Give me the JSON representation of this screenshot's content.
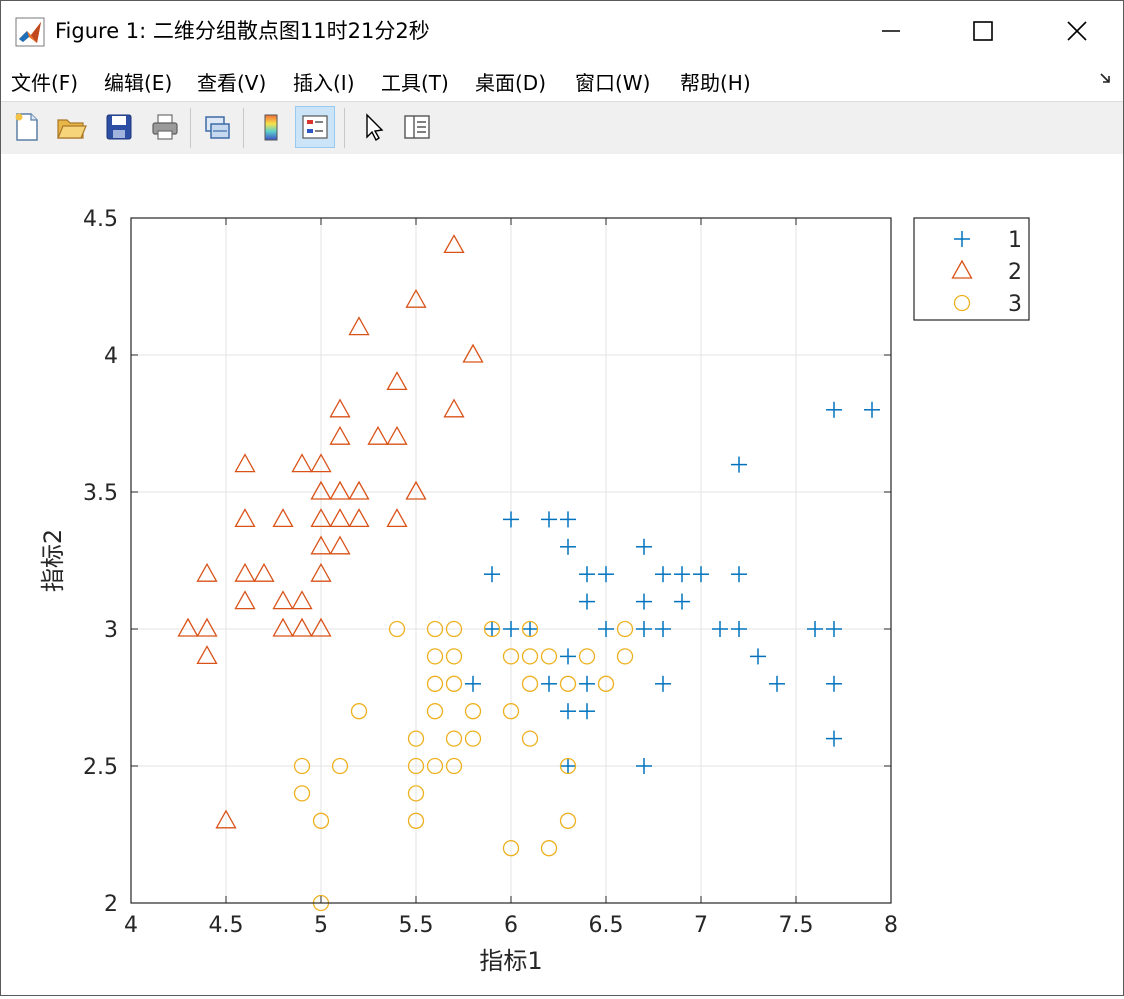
{
  "window": {
    "title": "Figure 1: 二维分组散点图11时21分2秒",
    "controls": {
      "minimize": "—",
      "maximize": "☐",
      "close": "✕"
    }
  },
  "menubar": {
    "items": [
      {
        "label": "文件(F)",
        "name": "menu-file"
      },
      {
        "label": "编辑(E)",
        "name": "menu-edit"
      },
      {
        "label": "查看(V)",
        "name": "menu-view"
      },
      {
        "label": "插入(I)",
        "name": "menu-insert"
      },
      {
        "label": "工具(T)",
        "name": "menu-tools"
      },
      {
        "label": "桌面(D)",
        "name": "menu-desktop"
      },
      {
        "label": "窗口(W)",
        "name": "menu-window"
      },
      {
        "label": "帮助(H)",
        "name": "menu-help"
      }
    ]
  },
  "toolbar": {
    "buttons": [
      {
        "icon": "new-figure-icon"
      },
      {
        "icon": "open-file-icon"
      },
      {
        "icon": "save-icon"
      },
      {
        "icon": "print-icon"
      },
      {
        "icon": "link-plot-icon"
      },
      {
        "icon": "colorbar-icon"
      },
      {
        "icon": "legend-icon",
        "active": true
      },
      {
        "icon": "edit-plot-pointer-icon"
      },
      {
        "icon": "property-inspector-icon"
      }
    ]
  },
  "chart_data": {
    "type": "scatter",
    "title": "",
    "xlabel": "指标1",
    "ylabel": "指标2",
    "xlim": [
      4,
      8
    ],
    "ylim": [
      2,
      4.5
    ],
    "xticks": [
      4,
      4.5,
      5,
      5.5,
      6,
      6.5,
      7,
      7.5,
      8
    ],
    "xtick_labels": [
      "4",
      "4.5",
      "5",
      "5.5",
      "6",
      "6.5",
      "7",
      "7.5",
      "8"
    ],
    "yticks": [
      2,
      2.5,
      3,
      3.5,
      4,
      4.5
    ],
    "ytick_labels": [
      "2",
      "2.5",
      "3",
      "3.5",
      "4",
      "4.5"
    ],
    "grid": true,
    "legend": "outside top-right",
    "series": [
      {
        "name": "1",
        "marker": "plus",
        "color": "#0072BD",
        "points": [
          [
            5.8,
            2.8
          ],
          [
            5.9,
            3.2
          ],
          [
            5.9,
            3.0
          ],
          [
            6.0,
            3.4
          ],
          [
            6.0,
            3.0
          ],
          [
            6.1,
            3.0
          ],
          [
            6.2,
            3.4
          ],
          [
            6.2,
            2.8
          ],
          [
            6.3,
            3.4
          ],
          [
            6.3,
            3.3
          ],
          [
            6.3,
            2.9
          ],
          [
            6.3,
            2.7
          ],
          [
            6.3,
            2.5
          ],
          [
            6.4,
            3.2
          ],
          [
            6.4,
            3.1
          ],
          [
            6.4,
            2.8
          ],
          [
            6.4,
            2.7
          ],
          [
            6.5,
            3.2
          ],
          [
            6.5,
            3.0
          ],
          [
            6.7,
            3.3
          ],
          [
            6.7,
            3.1
          ],
          [
            6.7,
            3.0
          ],
          [
            6.7,
            2.5
          ],
          [
            6.8,
            3.2
          ],
          [
            6.8,
            3.0
          ],
          [
            6.8,
            2.8
          ],
          [
            6.9,
            3.2
          ],
          [
            6.9,
            3.1
          ],
          [
            7.0,
            3.2
          ],
          [
            7.1,
            3.0
          ],
          [
            7.2,
            3.6
          ],
          [
            7.2,
            3.2
          ],
          [
            7.2,
            3.0
          ],
          [
            7.3,
            2.9
          ],
          [
            7.4,
            2.8
          ],
          [
            7.6,
            3.0
          ],
          [
            7.7,
            3.8
          ],
          [
            7.7,
            3.0
          ],
          [
            7.7,
            2.8
          ],
          [
            7.7,
            2.6
          ],
          [
            7.9,
            3.8
          ]
        ]
      },
      {
        "name": "2",
        "marker": "triangle",
        "color": "#D95319",
        "points": [
          [
            4.3,
            3.0
          ],
          [
            4.4,
            3.2
          ],
          [
            4.4,
            3.0
          ],
          [
            4.4,
            2.9
          ],
          [
            4.5,
            2.3
          ],
          [
            4.6,
            3.6
          ],
          [
            4.6,
            3.4
          ],
          [
            4.6,
            3.2
          ],
          [
            4.6,
            3.1
          ],
          [
            4.7,
            3.2
          ],
          [
            4.8,
            3.4
          ],
          [
            4.8,
            3.1
          ],
          [
            4.8,
            3.0
          ],
          [
            4.9,
            3.6
          ],
          [
            4.9,
            3.1
          ],
          [
            4.9,
            3.0
          ],
          [
            5.0,
            3.6
          ],
          [
            5.0,
            3.5
          ],
          [
            5.0,
            3.4
          ],
          [
            5.0,
            3.3
          ],
          [
            5.0,
            3.2
          ],
          [
            5.0,
            3.0
          ],
          [
            5.1,
            3.8
          ],
          [
            5.1,
            3.7
          ],
          [
            5.1,
            3.5
          ],
          [
            5.1,
            3.4
          ],
          [
            5.1,
            3.3
          ],
          [
            5.2,
            4.1
          ],
          [
            5.2,
            3.5
          ],
          [
            5.2,
            3.4
          ],
          [
            5.3,
            3.7
          ],
          [
            5.4,
            3.9
          ],
          [
            5.4,
            3.7
          ],
          [
            5.4,
            3.4
          ],
          [
            5.5,
            4.2
          ],
          [
            5.5,
            3.5
          ],
          [
            5.7,
            4.4
          ],
          [
            5.7,
            3.8
          ],
          [
            5.8,
            4.0
          ]
        ]
      },
      {
        "name": "3",
        "marker": "circle",
        "color": "#EDB120",
        "points": [
          [
            4.9,
            2.5
          ],
          [
            4.9,
            2.4
          ],
          [
            5.0,
            2.3
          ],
          [
            5.0,
            2.0
          ],
          [
            5.1,
            2.5
          ],
          [
            5.2,
            2.7
          ],
          [
            5.4,
            3.0
          ],
          [
            5.5,
            2.6
          ],
          [
            5.5,
            2.5
          ],
          [
            5.5,
            2.4
          ],
          [
            5.5,
            2.3
          ],
          [
            5.6,
            3.0
          ],
          [
            5.6,
            2.9
          ],
          [
            5.6,
            2.8
          ],
          [
            5.6,
            2.7
          ],
          [
            5.6,
            2.5
          ],
          [
            5.7,
            3.0
          ],
          [
            5.7,
            2.9
          ],
          [
            5.7,
            2.8
          ],
          [
            5.7,
            2.6
          ],
          [
            5.7,
            2.5
          ],
          [
            5.8,
            2.7
          ],
          [
            5.8,
            2.6
          ],
          [
            5.9,
            3.0
          ],
          [
            6.0,
            2.9
          ],
          [
            6.0,
            2.7
          ],
          [
            6.0,
            2.2
          ],
          [
            6.1,
            3.0
          ],
          [
            6.1,
            2.9
          ],
          [
            6.1,
            2.8
          ],
          [
            6.1,
            2.6
          ],
          [
            6.2,
            2.9
          ],
          [
            6.2,
            2.2
          ],
          [
            6.3,
            2.8
          ],
          [
            6.3,
            2.5
          ],
          [
            6.3,
            2.3
          ],
          [
            6.4,
            2.9
          ],
          [
            6.5,
            2.8
          ],
          [
            6.6,
            3.0
          ],
          [
            6.6,
            2.9
          ]
        ]
      }
    ]
  }
}
